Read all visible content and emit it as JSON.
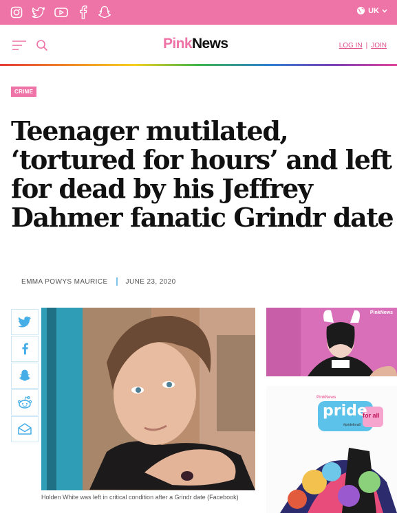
{
  "topbar": {
    "social_icons": [
      "instagram-icon",
      "twitter-icon",
      "youtube-icon",
      "facebook-icon",
      "snapchat-icon"
    ],
    "region_label": "UK",
    "color": "#ee73a6"
  },
  "header": {
    "logo_part1": "Pink",
    "logo_part2": "News",
    "login_label": "LOG IN",
    "join_label": "JOIN",
    "separator": "|"
  },
  "article": {
    "category": "CRIME",
    "headline": "Teenager mutilated, ‘tortured for hours’ and left for dead by his Jeffrey Dahmer fanatic Grindr date",
    "author": "EMMA POWYS MAURICE",
    "date": "JUNE 23, 2020",
    "caption": "Holden White was left in critical condition after a Grindr date (Facebook)"
  },
  "share_buttons": [
    "twitter-icon",
    "facebook-icon",
    "snapchat-icon",
    "reddit-icon",
    "email-icon"
  ],
  "sidebar": {
    "video_thumb_logo": "PinkNews",
    "promo_logo": "PinkNews",
    "promo_title": "pride",
    "promo_subtitle": "for all",
    "promo_hashtag": "#prideforall"
  },
  "colors": {
    "brand_pink": "#ee73a6",
    "accent_blue": "#7cc4e8",
    "share_icon_blue": "#45aee6"
  }
}
